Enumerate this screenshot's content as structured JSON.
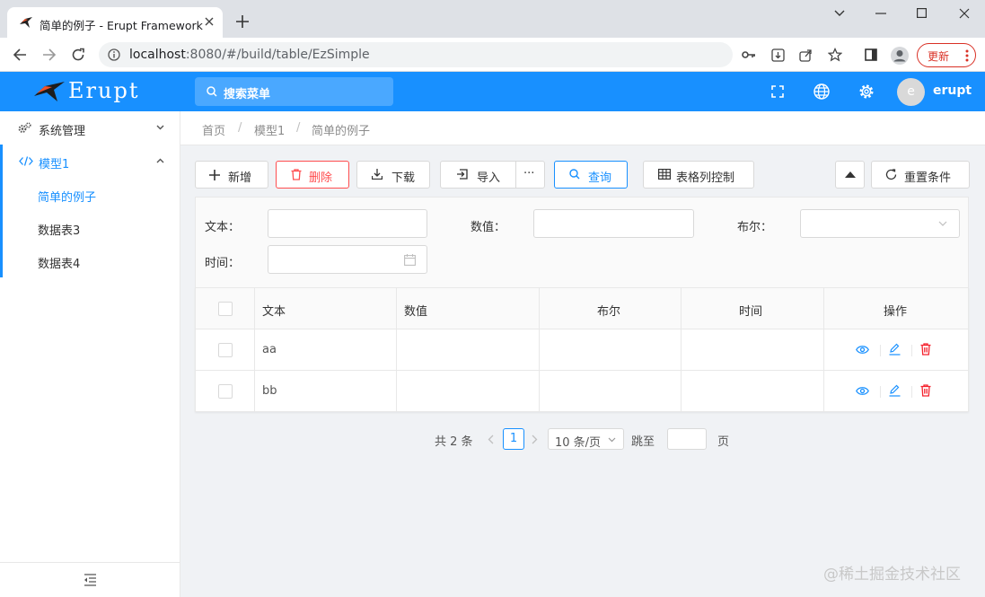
{
  "browser": {
    "tab_title": "简单的例子 - Erupt Framework",
    "url_host": "localhost",
    "url_rest": ":8080/#/build/table/EzSimple",
    "update_label": "更新"
  },
  "header": {
    "logo_text": "Erupt",
    "search_placeholder": "搜索菜单",
    "avatar_letter": "e",
    "username": "erupt",
    "brand_color": "#1890ff"
  },
  "sidebar": {
    "items": [
      {
        "label": "系统管理",
        "icon": "gears-icon",
        "expanded": false
      },
      {
        "label": "模型1",
        "icon": "code-icon",
        "expanded": true
      },
      {
        "label": "简单的例子",
        "active": true
      },
      {
        "label": "数据表3"
      },
      {
        "label": "数据表4"
      }
    ]
  },
  "breadcrumb": [
    "首页",
    "模型1",
    "简单的例子"
  ],
  "toolbar": {
    "add": "新增",
    "delete": "删除",
    "download": "下载",
    "import": "导入",
    "more": "···",
    "query": "查询",
    "column_control": "表格列控制",
    "reset": "重置条件"
  },
  "filters": {
    "text_label": "文本：",
    "number_label": "数值：",
    "bool_label": "布尔：",
    "time_label": "时间："
  },
  "table": {
    "columns": [
      "文本",
      "数值",
      "布尔",
      "时间",
      "操作"
    ],
    "rows": [
      {
        "text": "aa",
        "number": "",
        "bool": "",
        "time": ""
      },
      {
        "text": "bb",
        "number": "",
        "bool": "",
        "time": ""
      }
    ]
  },
  "pagination": {
    "total": "共 2 条",
    "current_page": "1",
    "page_size": "10 条/页",
    "jump_label": "跳至",
    "page_suffix": "页"
  },
  "watermark": "@稀土掘金技术社区"
}
